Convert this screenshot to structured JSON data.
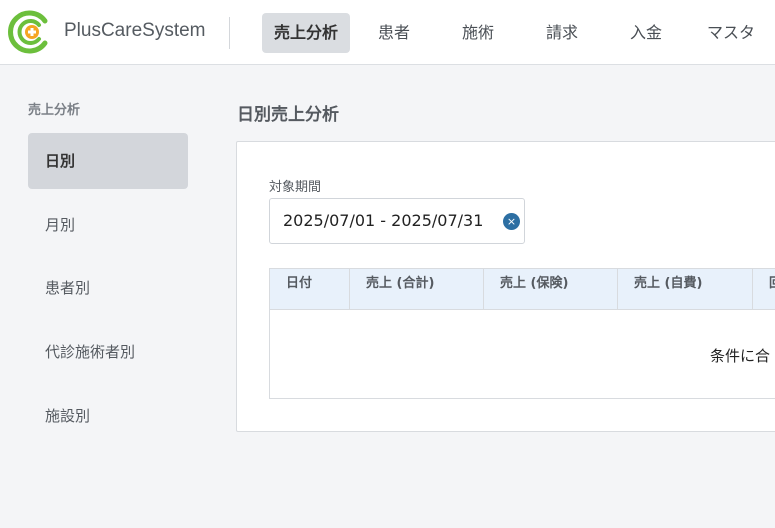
{
  "header": {
    "app_name": "PlusCareSystem",
    "nav": [
      {
        "label": "売上分析",
        "active": true
      },
      {
        "label": "患者"
      },
      {
        "label": "施術"
      },
      {
        "label": "請求"
      },
      {
        "label": "入金"
      },
      {
        "label": "マスタ"
      }
    ]
  },
  "sidebar": {
    "title": "売上分析",
    "items": [
      {
        "label": "日別",
        "active": true
      },
      {
        "label": "月別"
      },
      {
        "label": "患者別"
      },
      {
        "label": "代診施術者別"
      },
      {
        "label": "施設別"
      }
    ]
  },
  "main": {
    "title": "日別売上分析",
    "period_label": "対象期間",
    "period_value": "2025/07/01 - 2025/07/31",
    "clear_icon": "×",
    "table": {
      "columns": [
        "日付",
        "売上 (合計)",
        "売上 (保険)",
        "売上 (自費)",
        "回"
      ],
      "empty_message": "条件に合"
    }
  },
  "colors": {
    "logo_green": "#6cbf3c",
    "logo_orange": "#f5a623",
    "accent_blue": "#2d6fa3",
    "table_header_bg": "#e8f1fb"
  }
}
